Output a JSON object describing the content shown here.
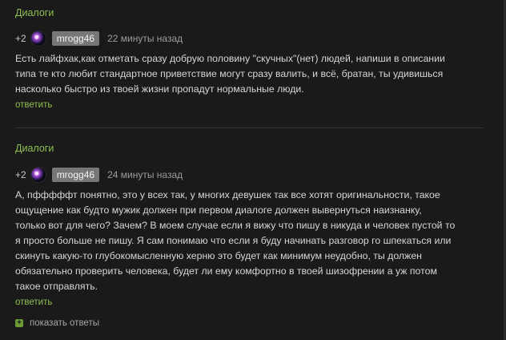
{
  "comments": [
    {
      "section": "Диалоги",
      "rating": "+2",
      "username": "mrogg46",
      "time": "22 минуты назад",
      "lines": [
        "Есть лайфхак,как отметать сразу добрую половину \"скучных\"(нет) людей, напиши в описании",
        "типа те кто любит стандартное приветствие могут сразу валить, и всё, братан, ты удивишься",
        "насколько быстро из твоей жизни пропадут нормальные люди."
      ],
      "reply": "ответить"
    },
    {
      "section": "Диалоги",
      "rating": "+2",
      "username": "mrogg46",
      "time": "24 минуты назад",
      "lines": [
        "А, пфффффт понятно, это у всех так, у многих девушек так все хотят оригинальности, такое",
        "ощущение как будто мужик должен при первом диалоге должен вывернуться наизнанку,",
        "только вот для чего? Зачем? В моем случае если я вижу что пишу в никуда и человек пустой то",
        "я просто больше не пишу. Я сам понимаю что если я буду начинать разговор го шпекаться или",
        "скинуть какую-то глубокомысленную херню это будет как минимум неудобно, ты должен",
        "обязательно проверить человека, будет ли ему комфортно в твоей шизофрении а уж потом",
        "такое отправлять."
      ],
      "reply": "ответить"
    }
  ],
  "show_replies": "показать ответы",
  "colors": {
    "background": "#1a1a1a",
    "accent": "#8fbf4c",
    "username_badge": "#777777"
  },
  "icons": {
    "avatar": "purple-nebula-avatar",
    "expand": "plus-square-icon"
  }
}
